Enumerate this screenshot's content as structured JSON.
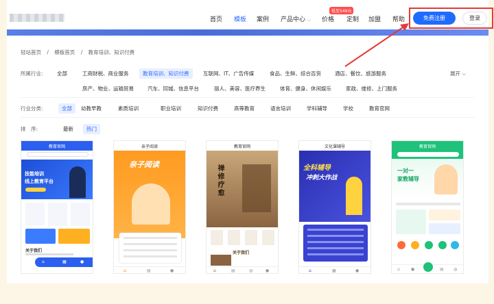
{
  "header": {
    "nav": [
      {
        "label": "首页",
        "active": false
      },
      {
        "label": "模板",
        "active": true
      },
      {
        "label": "案例",
        "active": false
      },
      {
        "label": "产品中心",
        "active": false
      },
      {
        "label": "价格",
        "active": false
      },
      {
        "label": "定制",
        "active": false
      },
      {
        "label": "加盟",
        "active": false
      },
      {
        "label": "帮助",
        "active": false
      }
    ],
    "sale_badge": "低至549元",
    "register": "免费注册",
    "login": "登录"
  },
  "breadcrumb": [
    "轻站首页",
    "/",
    "模板首页",
    "/",
    "教育培训、知识付费"
  ],
  "filters": {
    "industry_label": "所属行业:",
    "industry_row1": [
      "全部",
      "工商财税、商业服务",
      "教育培训、知识付费",
      "互联网、IT、广告传媒",
      "食品、生鲜、综合百货",
      "酒店、餐饮、旅游服务"
    ],
    "industry_row2": [
      "房产、物业、运输贸易",
      "汽车、同城、信息平台",
      "丽人、美容、医疗养生",
      "体育、健身、休闲娱乐",
      "家政、维修、上门服务"
    ],
    "expand": "展开",
    "category_label": "行业分类:",
    "categories": [
      "全部",
      "幼教早教",
      "素质培训",
      "职业培训",
      "知识付费",
      "高等教育",
      "语言培训",
      "学科辅导",
      "学校",
      "教育官网"
    ],
    "sort_label": "排　序:",
    "sorts": [
      "最新",
      "热门"
    ]
  },
  "cards": [
    {
      "title": "教育官网",
      "hero_1": "技能培训",
      "hero_2": "线上教育平台",
      "section": "关于我们"
    },
    {
      "title": "亲子阅读",
      "hero": "亲子阅读"
    },
    {
      "title": "教育官网",
      "hero": "禅修疗愈",
      "section": "关于我们"
    },
    {
      "title": "文化课辅导",
      "hero_1": "全科辅导",
      "hero_2": "冲刺大作战"
    },
    {
      "title": "教育官网",
      "hero_1": "一对一",
      "hero_2": "家教辅导"
    }
  ],
  "colors": {
    "accent": "#1f6bff",
    "highlight": "#e53935",
    "badge": "#ff4d4f"
  }
}
